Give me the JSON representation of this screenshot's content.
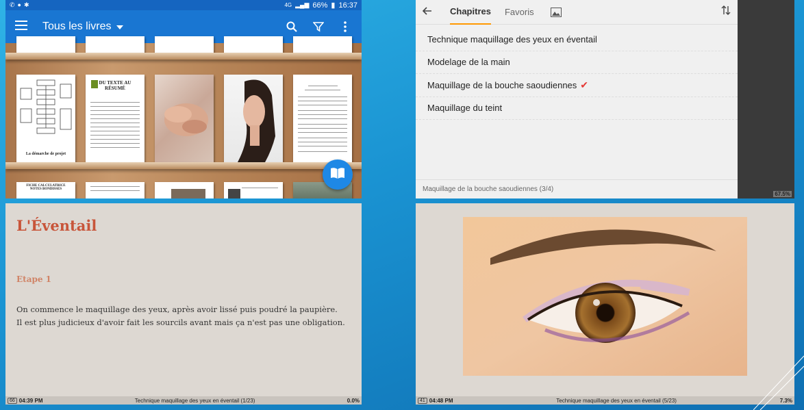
{
  "library": {
    "status": {
      "left_icons": [
        "signal-icon",
        "shield-icon",
        "settings-icon"
      ],
      "network": "4G",
      "battery": "66%",
      "time": "16:37"
    },
    "appbar": {
      "title": "Tous les livres",
      "icons": [
        "menu-icon",
        "dropdown-icon",
        "search-icon",
        "filter-icon",
        "more-vert-icon"
      ]
    },
    "books": [
      {
        "name": "flowchart-book",
        "title": "La démarche de projet"
      },
      {
        "name": "text-book",
        "title": "DU TEXTE AU RÉSUMÉ"
      },
      {
        "name": "hands-book",
        "title": ""
      },
      {
        "name": "portrait-book",
        "title": ""
      },
      {
        "name": "exam-book",
        "title": ""
      }
    ],
    "bottom_row": [
      "FICHE CALCULATRICE NOTES BONDISSES",
      "",
      "",
      "",
      ""
    ],
    "fab_icon": "book-open-icon"
  },
  "chapters": {
    "tabs": [
      "Chapitres",
      "Favoris"
    ],
    "active_tab": "Chapitres",
    "items": [
      {
        "label": "Technique maquillage des yeux en éventail",
        "checked": false
      },
      {
        "label": "Modelage de la main",
        "checked": false
      },
      {
        "label": "Maquillage de la bouche saoudiennes",
        "checked": true
      },
      {
        "label": "Maquillage du teint",
        "checked": false
      }
    ],
    "footer": "Maquillage de la bouche saoudiennes (3/4)",
    "side_pct": "67.5%",
    "colors": {
      "accent": "#ff9800",
      "check": "#e53935"
    }
  },
  "reader_text": {
    "title": "L'Éventail",
    "step": "Etape 1",
    "body": "On commence le maquillage des yeux, après avoir lissé puis poudré la paupière. Il est plus judicieux d'avoir fait les sourcils avant mais ça n'est pas une obligation.",
    "footer": {
      "page": "66",
      "time": "04:39 PM",
      "chapter": "Technique maquillage des yeux en éventail (1/23)",
      "pct": "0.0%"
    },
    "colors": {
      "title": "#c8553a",
      "step": "#d08467"
    }
  },
  "reader_image": {
    "image": "eye-photo",
    "footer": {
      "page": "41",
      "time": "04:48 PM",
      "chapter": "Technique maquillage des yeux en éventail (5/23)",
      "pct": "7.3%"
    }
  }
}
